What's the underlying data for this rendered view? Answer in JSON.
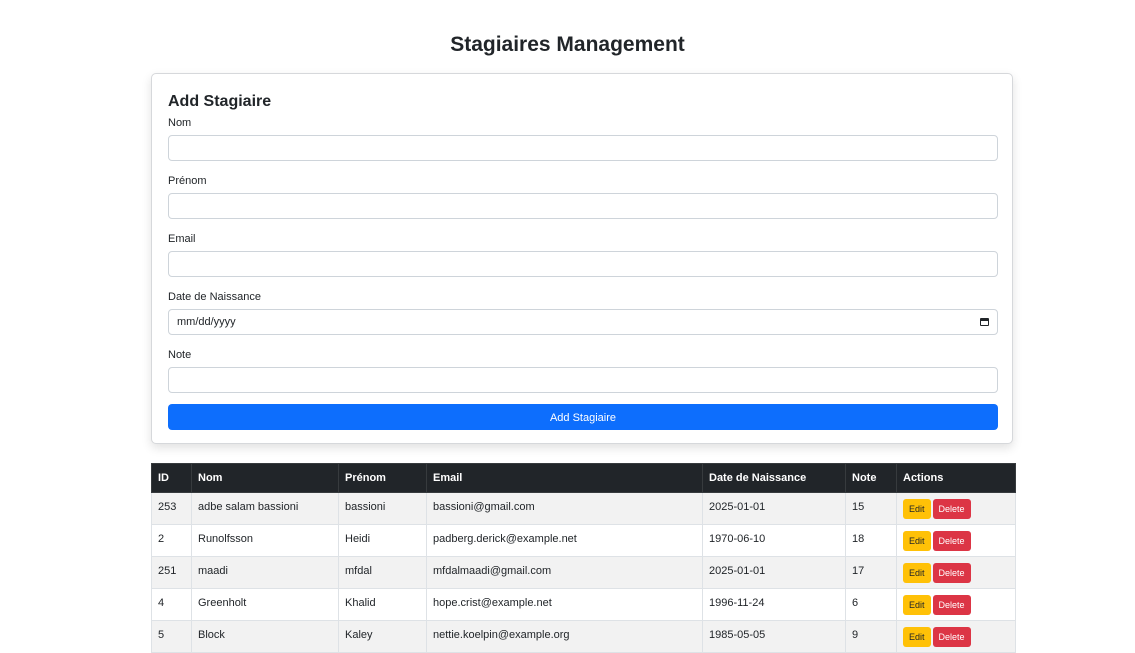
{
  "page": {
    "title": "Stagiaires Management"
  },
  "form": {
    "title": "Add Stagiaire",
    "fields": [
      {
        "label": "Nom",
        "value": ""
      },
      {
        "label": "Prénom",
        "value": ""
      },
      {
        "label": "Email",
        "value": ""
      },
      {
        "label": "Date de Naissance",
        "placeholder": "mm/dd/yyyy"
      },
      {
        "label": "Note",
        "value": ""
      }
    ],
    "submit_label": "Add Stagiaire"
  },
  "table": {
    "headers": [
      "ID",
      "Nom",
      "Prénom",
      "Email",
      "Date de Naissance",
      "Note",
      "Actions"
    ],
    "edit_label": "Edit",
    "delete_label": "Delete",
    "rows": [
      {
        "id": "253",
        "nom": "adbe salam bassioni",
        "prenom": "bassioni",
        "email": "bassioni@gmail.com",
        "date": "2025-01-01",
        "note": "15"
      },
      {
        "id": "2",
        "nom": "Runolfsson",
        "prenom": "Heidi",
        "email": "padberg.derick@example.net",
        "date": "1970-06-10",
        "note": "18"
      },
      {
        "id": "251",
        "nom": "maadi",
        "prenom": "mfdal",
        "email": "mfdalmaadi@gmail.com",
        "date": "2025-01-01",
        "note": "17"
      },
      {
        "id": "4",
        "nom": "Greenholt",
        "prenom": "Khalid",
        "email": "hope.crist@example.net",
        "date": "1996-11-24",
        "note": "6"
      },
      {
        "id": "5",
        "nom": "Block",
        "prenom": "Kaley",
        "email": "nettie.koelpin@example.org",
        "date": "1985-05-05",
        "note": "9"
      }
    ]
  },
  "colors": {
    "primary": "#0d6efd",
    "warning": "#ffc107",
    "danger": "#dc3545",
    "dark": "#212529"
  }
}
